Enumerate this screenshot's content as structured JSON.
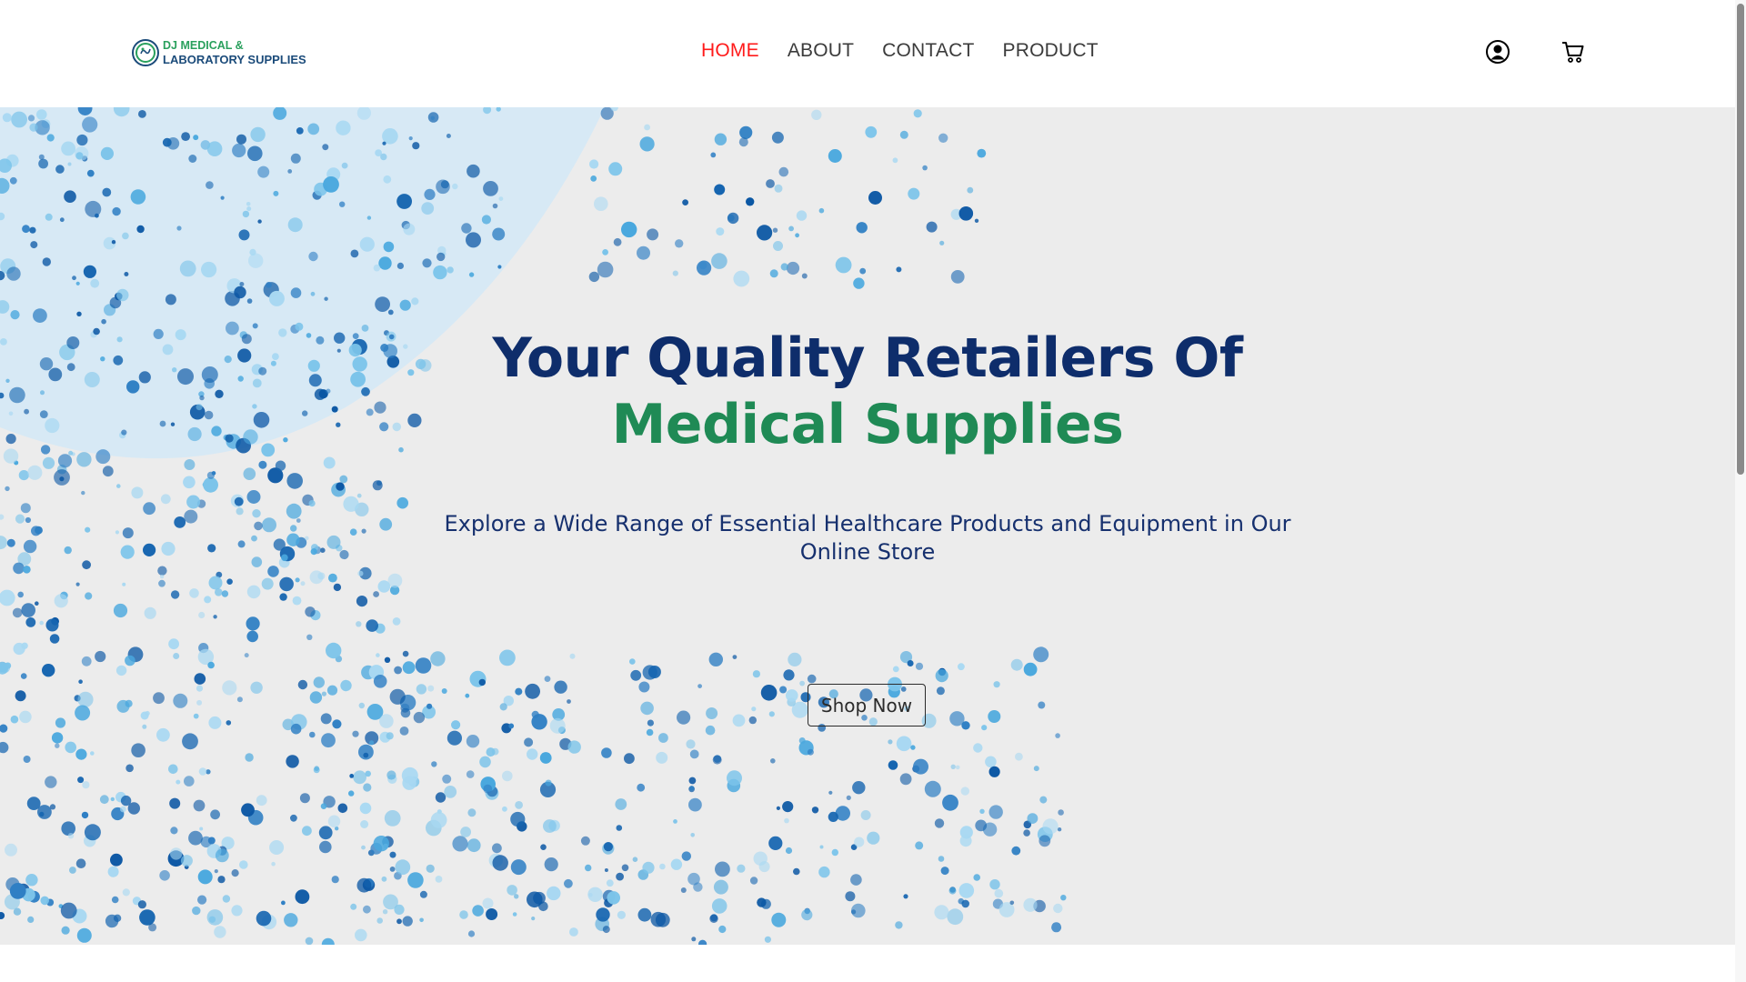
{
  "brand": {
    "line1": "DJ MEDICAL &",
    "line2": "LABORATORY SUPPLIES",
    "accent_green": "#2aa05d",
    "accent_blue": "#1b4b7a"
  },
  "nav": {
    "items": [
      {
        "label": "HOME",
        "active": true
      },
      {
        "label": "ABOUT",
        "active": false
      },
      {
        "label": "CONTACT",
        "active": false
      },
      {
        "label": "PRODUCT",
        "active": false
      }
    ],
    "active_color": "#ff1a1a"
  },
  "header_icons": {
    "account": "user-circle-icon",
    "cart": "shopping-cart-icon"
  },
  "hero": {
    "title_line1": "Your Quality Retailers Of",
    "title_line2": "Medical Supplies",
    "subtitle": "Explore a Wide Range of Essential Healthcare Products and Equipment in Our Online Store",
    "cta_label": "Shop Now",
    "title_color": "#0e2d6b",
    "highlight_color": "#1f8a55",
    "background_color": "#ececec"
  },
  "page_load_progress": 0.2
}
